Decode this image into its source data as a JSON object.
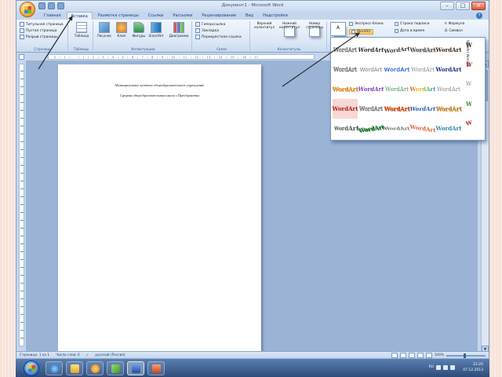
{
  "window": {
    "title": "Документ1 - Microsoft Word",
    "controls": {
      "minimize": "–",
      "maximize": "□",
      "close": "×"
    }
  },
  "tabs": [
    "Главная",
    "Вставка",
    "Разметка страницы",
    "Ссылки",
    "Рассылки",
    "Рецензирование",
    "Вид",
    "Надстройки"
  ],
  "ribbon": {
    "groups": [
      {
        "label": "Страницы",
        "items": [
          "Титульная страница",
          "Пустая страница",
          "Разрыв страницы"
        ]
      },
      {
        "label": "Таблицы",
        "buttons": [
          "Таблица"
        ]
      },
      {
        "label": "Иллюстрации",
        "buttons": [
          "Рисунок",
          "Клип",
          "Фигуры",
          "SmartArt",
          "Диаграмма"
        ]
      },
      {
        "label": "Связи",
        "items": [
          "Гиперссылка",
          "Закладка",
          "Перекрестная ссылка"
        ]
      },
      {
        "label": "Колонтитулы",
        "buttons": [
          "Верхний колонтитул",
          "Нижний колонтитул",
          "Номер страницы"
        ]
      }
    ],
    "text_group": {
      "textbox": "A",
      "express_blocks": "Экспресс-блоки",
      "wordart": "WordArt",
      "signature": "Строка подписи",
      "datetime": "Дата и время",
      "formula": "Формула",
      "symbol": "Символ"
    }
  },
  "ruler": "· 2 · ı · 1 · ı · · · ı · 1 · ı · 2 · ı · 3 · ı · 4 · ı · 5 · ı · 6 · ı · 7 · ı · 8 · ı · 9 · ı · 10 · ı · 11 · ı · 12 · ı · 13 · ı · 14 · ı · 15 · ı · 16 · ı · 17",
  "document": {
    "line1": "Муниципальное казенное общеобразовательное учреждение",
    "line2": "Средняя общеобразовательная школа с.Преображенка"
  },
  "wordart_gallery": {
    "items": [
      "WordArt",
      "WordArt",
      "WordArt",
      "WordArt",
      "WordArt",
      "WordArt",
      "WordArt",
      "WordArt",
      "WordArt",
      "WordArt",
      "WordArt",
      "WordArt",
      "WordArt",
      "WordArt",
      "WordArt",
      "WordArt",
      "WordArt",
      "WordArt",
      "WordArt",
      "WordArt",
      "WordArt",
      "WordArt",
      "WordArt",
      "WordArt",
      "WordArt"
    ],
    "column6": [
      "W",
      "W",
      "W",
      "W",
      "W"
    ],
    "vertical_text": "WordArt WordArt"
  },
  "status": {
    "page": "Страница: 1 из 1",
    "words": "Число слов: 6",
    "language": "русский (Россия)",
    "zoom": "100%"
  },
  "taskbar": {
    "lang": "RU",
    "time": "21:25",
    "date": "07.12.2013"
  },
  "colors": {
    "ribbon_bg": "#dbe7f6",
    "accent": "#15428b",
    "arrow": "#2a2a2a",
    "gallery_highlight": "#f8c75f"
  }
}
